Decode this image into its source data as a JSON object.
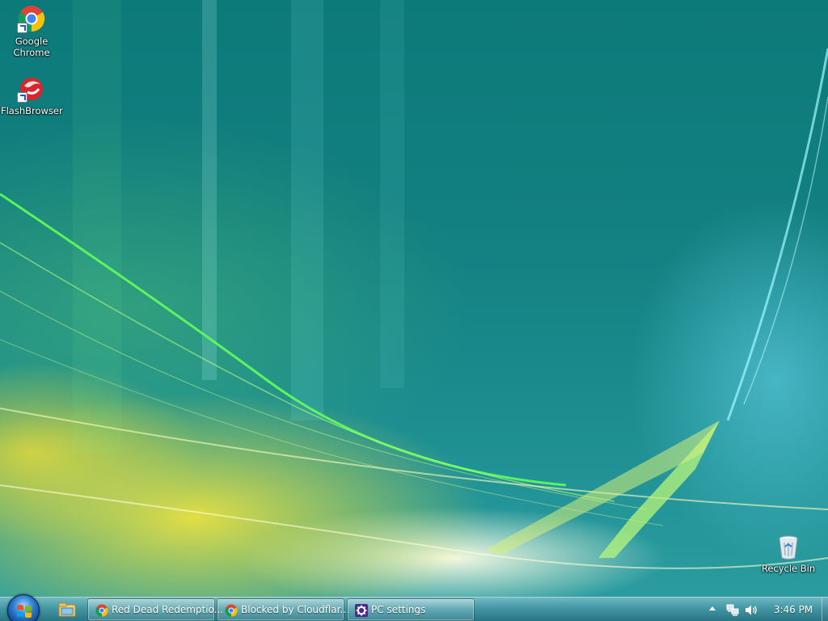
{
  "desktop": {
    "icons": [
      {
        "label": "Google Chrome",
        "icon": "chrome-icon"
      },
      {
        "label": "FlashBrowser",
        "icon": "flashbrowser-icon"
      },
      {
        "label": "Recycle Bin",
        "icon": "recycle-bin-icon"
      }
    ]
  },
  "taskbar": {
    "start_icon": "windows-start-orb",
    "quick_launch_icon": "file-explorer-icon",
    "buttons": [
      {
        "label": "Red Dead Redemptio...",
        "icon": "chrome-icon"
      },
      {
        "label": "Blocked by Cloudflar...",
        "icon": "chrome-icon"
      },
      {
        "label": "PC settings",
        "icon": "gear-icon"
      }
    ],
    "tray": {
      "icons": [
        "show-hidden-icons-arrow",
        "network-icon",
        "volume-icon"
      ],
      "clock": "3:46 PM"
    }
  },
  "colors": {
    "wallpaper_teal": "#127f80",
    "wallpaper_yellow": "#ece240",
    "taskbar": "#4a96a5"
  }
}
